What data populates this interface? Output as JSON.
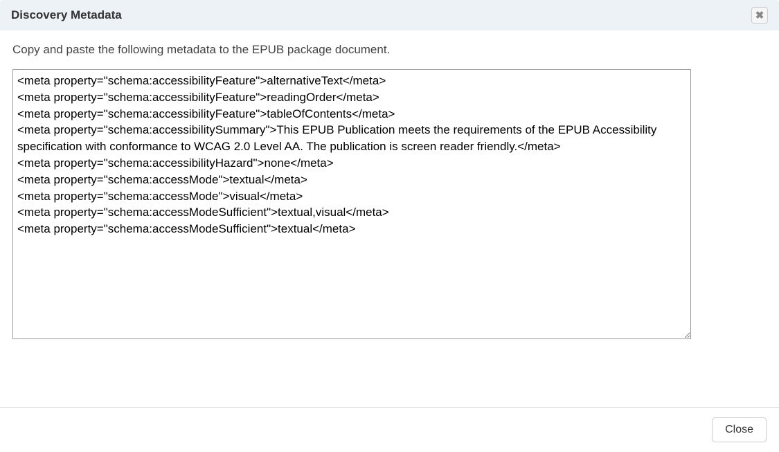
{
  "dialog": {
    "title": "Discovery Metadata",
    "instruction": "Copy and paste the following metadata to the EPUB package document.",
    "metadata_text": "<meta property=\"schema:accessibilityFeature\">alternativeText</meta>\n<meta property=\"schema:accessibilityFeature\">readingOrder</meta>\n<meta property=\"schema:accessibilityFeature\">tableOfContents</meta>\n<meta property=\"schema:accessibilitySummary\">This EPUB Publication meets the requirements of the EPUB Accessibility specification with conformance to WCAG 2.0 Level AA. The publication is screen reader friendly.</meta>\n<meta property=\"schema:accessibilityHazard\">none</meta>\n<meta property=\"schema:accessMode\">textual</meta>\n<meta property=\"schema:accessMode\">visual</meta>\n<meta property=\"schema:accessModeSufficient\">textual,visual</meta>\n<meta property=\"schema:accessModeSufficient\">textual</meta>",
    "close_button_label": "Close",
    "close_x_label": "✖"
  }
}
